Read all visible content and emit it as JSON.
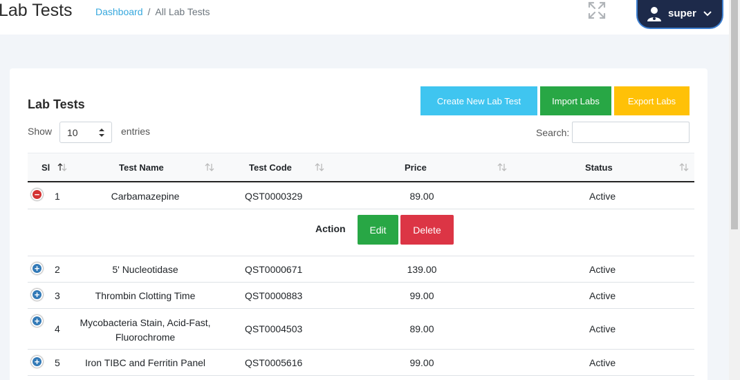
{
  "header": {
    "title": "Lab Tests",
    "breadcrumb": {
      "home": "Dashboard",
      "separator": "/",
      "current": "All Lab Tests"
    },
    "user": {
      "name": "super"
    }
  },
  "card": {
    "title": "Lab Tests",
    "buttons": {
      "create": "Create New Lab Test",
      "import": "Import Labs",
      "export": "Export Labs"
    },
    "show_label": "Show",
    "page_size": "10",
    "entries_label": "entries",
    "search_label": "Search:",
    "search_value": ""
  },
  "table": {
    "columns": [
      "Sl",
      "Test Name",
      "Test Code",
      "Price",
      "Status"
    ],
    "rows": [
      {
        "sl": "1",
        "name": "Carbamazepine",
        "code": "QST0000329",
        "price": "89.00",
        "status": "Active",
        "expanded": true
      },
      {
        "sl": "2",
        "name": "5' Nucleotidase",
        "code": "QST0000671",
        "price": "139.00",
        "status": "Active",
        "expanded": false
      },
      {
        "sl": "3",
        "name": "Thrombin Clotting Time",
        "code": "QST0000883",
        "price": "99.00",
        "status": "Active",
        "expanded": false
      },
      {
        "sl": "4",
        "name_line1": "Mycobacteria Stain, Acid-Fast,",
        "name_line2": "Fluorochrome",
        "code": "QST0004503",
        "price": "89.00",
        "status": "Active",
        "expanded": false
      },
      {
        "sl": "5",
        "name": "Iron TIBC and Ferritin Panel",
        "code": "QST0005616",
        "price": "99.00",
        "status": "Active",
        "expanded": false
      }
    ],
    "child_row": {
      "action_label": "Action",
      "edit": "Edit",
      "delete": "Delete"
    }
  },
  "colors": {
    "create": "#3fc5f0",
    "import": "#28a745",
    "export": "#ffc107",
    "edit": "#28a745",
    "delete": "#dc3545",
    "link": "#35a7dd",
    "user_bg": "#1d2a4a"
  }
}
